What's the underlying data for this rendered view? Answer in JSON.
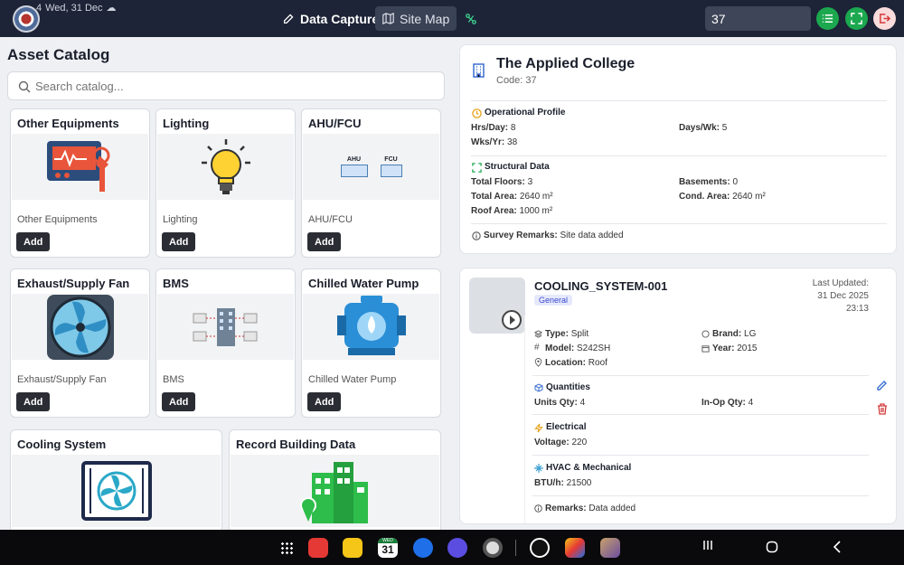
{
  "status_bar": {
    "time": "4",
    "date": "Wed, 31 Dec"
  },
  "header": {
    "nav": [
      {
        "label": "Data Capture",
        "icon": "edit-icon",
        "active": true
      },
      {
        "label": "Site Map",
        "icon": "map-icon",
        "active": false
      }
    ],
    "site_code_value": "37",
    "colors": {
      "bar": "#1d2437",
      "green": "#1ca84f",
      "exit_bg": "#fadcdc"
    }
  },
  "catalog": {
    "title": "Asset Catalog",
    "search_placeholder": "Search catalog...",
    "add_label": "Add",
    "items": [
      {
        "title": "Other Equipments",
        "subtitle": "Other Equipments"
      },
      {
        "title": "Lighting",
        "subtitle": "Lighting"
      },
      {
        "title": "AHU/FCU",
        "subtitle": "AHU/FCU",
        "img_labels": [
          "AHU",
          "FCU"
        ]
      },
      {
        "title": "Exhaust/Supply Fan",
        "subtitle": "Exhaust/Supply Fan"
      },
      {
        "title": "BMS",
        "subtitle": "BMS"
      },
      {
        "title": "Chilled Water Pump",
        "subtitle": "Chilled Water Pump"
      },
      {
        "title": "Cooling System"
      },
      {
        "title": "Record Building Data"
      }
    ]
  },
  "site": {
    "name": "The Applied College",
    "code": "Code: 37",
    "operational": {
      "title": "Operational Profile",
      "hrs_day_label": "Hrs/Day:",
      "hrs_day": "8",
      "days_wk_label": "Days/Wk:",
      "days_wk": "5",
      "wks_yr_label": "Wks/Yr:",
      "wks_yr": "38"
    },
    "structural": {
      "title": "Structural Data",
      "floors_label": "Total Floors:",
      "floors": "3",
      "basements_label": "Basements:",
      "basements": "0",
      "total_area_label": "Total Area:",
      "total_area": "2640 m²",
      "cond_area_label": "Cond. Area:",
      "cond_area": "2640 m²",
      "roof_area_label": "Roof Area:",
      "roof_area": "1000 m²"
    },
    "remarks_label": "Survey Remarks:",
    "remarks": "Site data added"
  },
  "equipment": {
    "id": "COOLING_SYSTEM-001",
    "badge": "General",
    "updated_label": "Last Updated:",
    "updated_date": "31 Dec 2025",
    "updated_time": "23:13",
    "type_label": "Type:",
    "type": "Split",
    "brand_label": "Brand:",
    "brand": "LG",
    "model_label": "Model:",
    "model": "S242SH",
    "year_label": "Year:",
    "year": "2015",
    "location_label": "Location:",
    "location": "Roof",
    "quantities_title": "Quantities",
    "units_label": "Units Qty:",
    "units": "4",
    "inop_label": "In-Op Qty:",
    "inop": "4",
    "electrical_title": "Electrical",
    "voltage_label": "Voltage:",
    "voltage": "220",
    "hvac_title": "HVAC & Mechanical",
    "btu_label": "BTU/h:",
    "btu": "21500",
    "remarks_label": "Remarks:",
    "remarks": "Data added"
  },
  "taskbar": {
    "calendar_day": "31",
    "calendar_weekday": "WED",
    "apps": [
      "apps-grid-icon",
      "notes-app-icon",
      "files-app-icon",
      "calendar-app-icon",
      "messages-app-icon",
      "browser-app-icon",
      "camera-app-icon",
      "chatgpt-app-icon",
      "game-app-icon",
      "gallery-app-icon"
    ]
  }
}
